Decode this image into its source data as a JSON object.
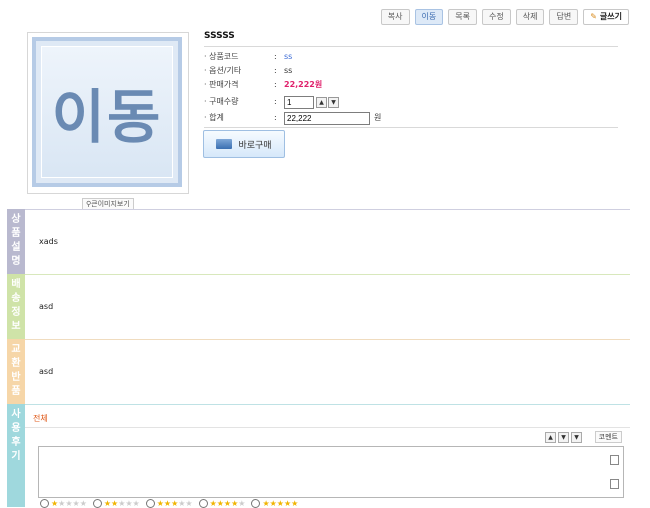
{
  "toolbar": {
    "copy": "복사",
    "move": "이동",
    "list": "목록",
    "edit": "수정",
    "delete": "삭제",
    "reply": "답변",
    "write": "글쓰기"
  },
  "product": {
    "thumb_text": "이동",
    "zoom_label": "큰이미지보기",
    "name": "SSSSS",
    "fields": {
      "code_label": "· 상품코드",
      "code_value": "ss",
      "option_label": "· 옵션/기타",
      "option_value": "ss",
      "price_label": "· 판매가격",
      "price_value": "22,222원",
      "qty_label": "· 구매수량",
      "qty_value": "1",
      "total_label": "· 합계",
      "total_value": "22,222",
      "won": "원"
    },
    "buy_label": "바로구매"
  },
  "sections": {
    "desc_tab": "상품설명",
    "desc_text": "xads",
    "ship_tab": "배송정보",
    "ship_text": "asd",
    "exchange_tab": "교환반품",
    "exchange_text": "asd",
    "review_tab": "사용후기",
    "review_all": "전체",
    "comment_button": "코멘트"
  },
  "ratings": [
    1,
    2,
    3,
    4,
    5
  ]
}
